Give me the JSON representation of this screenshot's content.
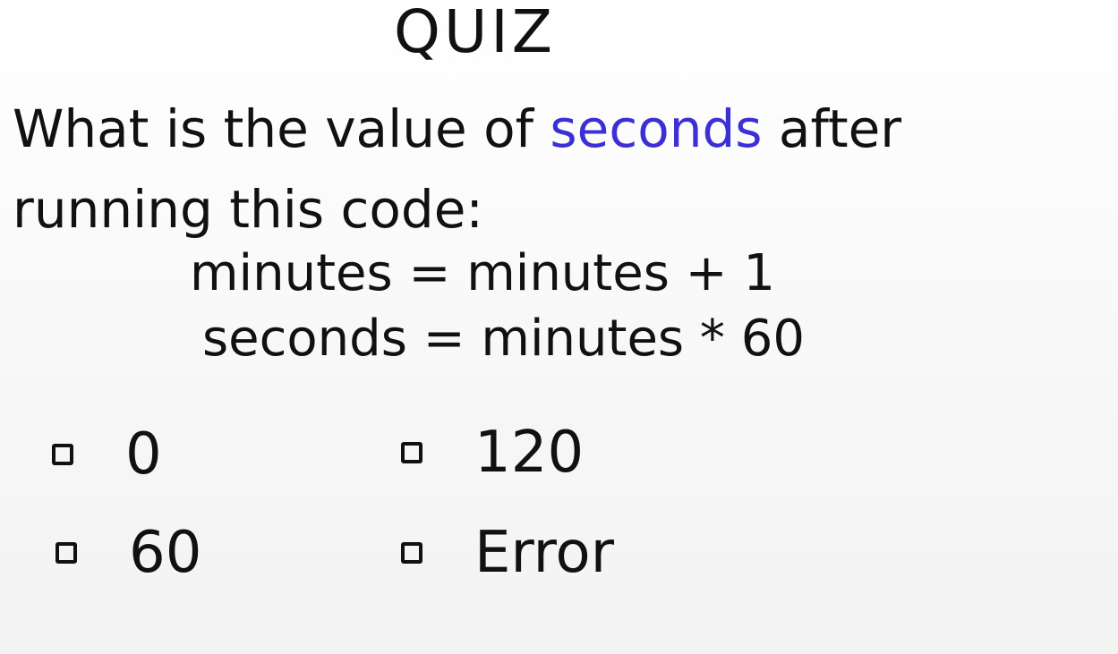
{
  "title": "QUIZ",
  "question": {
    "before": "What is the value of ",
    "keyword": "seconds",
    "after": " after running this code:"
  },
  "code": {
    "line1": "minutes = minutes + 1",
    "line2": "seconds = minutes * 60"
  },
  "options": [
    {
      "label": "0"
    },
    {
      "label": "120"
    },
    {
      "label": "60"
    },
    {
      "label": "Error"
    }
  ],
  "colors": {
    "keyword": "#3b2fd6",
    "ink": "#111111"
  }
}
